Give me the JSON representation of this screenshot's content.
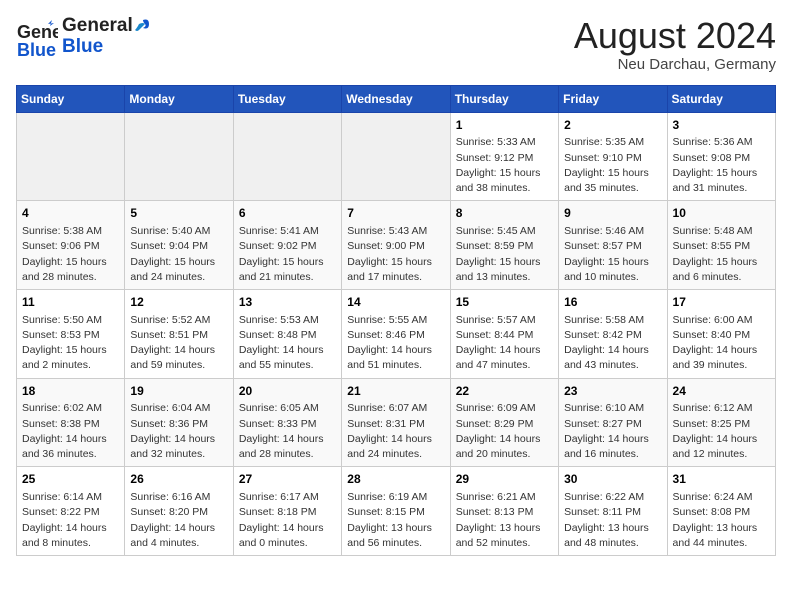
{
  "header": {
    "logo_general": "General",
    "logo_blue": "Blue",
    "title": "August 2024",
    "subtitle": "Neu Darchau, Germany"
  },
  "weekdays": [
    "Sunday",
    "Monday",
    "Tuesday",
    "Wednesday",
    "Thursday",
    "Friday",
    "Saturday"
  ],
  "weeks": [
    [
      {
        "day": "",
        "info": ""
      },
      {
        "day": "",
        "info": ""
      },
      {
        "day": "",
        "info": ""
      },
      {
        "day": "",
        "info": ""
      },
      {
        "day": "1",
        "info": "Sunrise: 5:33 AM\nSunset: 9:12 PM\nDaylight: 15 hours\nand 38 minutes."
      },
      {
        "day": "2",
        "info": "Sunrise: 5:35 AM\nSunset: 9:10 PM\nDaylight: 15 hours\nand 35 minutes."
      },
      {
        "day": "3",
        "info": "Sunrise: 5:36 AM\nSunset: 9:08 PM\nDaylight: 15 hours\nand 31 minutes."
      }
    ],
    [
      {
        "day": "4",
        "info": "Sunrise: 5:38 AM\nSunset: 9:06 PM\nDaylight: 15 hours\nand 28 minutes."
      },
      {
        "day": "5",
        "info": "Sunrise: 5:40 AM\nSunset: 9:04 PM\nDaylight: 15 hours\nand 24 minutes."
      },
      {
        "day": "6",
        "info": "Sunrise: 5:41 AM\nSunset: 9:02 PM\nDaylight: 15 hours\nand 21 minutes."
      },
      {
        "day": "7",
        "info": "Sunrise: 5:43 AM\nSunset: 9:00 PM\nDaylight: 15 hours\nand 17 minutes."
      },
      {
        "day": "8",
        "info": "Sunrise: 5:45 AM\nSunset: 8:59 PM\nDaylight: 15 hours\nand 13 minutes."
      },
      {
        "day": "9",
        "info": "Sunrise: 5:46 AM\nSunset: 8:57 PM\nDaylight: 15 hours\nand 10 minutes."
      },
      {
        "day": "10",
        "info": "Sunrise: 5:48 AM\nSunset: 8:55 PM\nDaylight: 15 hours\nand 6 minutes."
      }
    ],
    [
      {
        "day": "11",
        "info": "Sunrise: 5:50 AM\nSunset: 8:53 PM\nDaylight: 15 hours\nand 2 minutes."
      },
      {
        "day": "12",
        "info": "Sunrise: 5:52 AM\nSunset: 8:51 PM\nDaylight: 14 hours\nand 59 minutes."
      },
      {
        "day": "13",
        "info": "Sunrise: 5:53 AM\nSunset: 8:48 PM\nDaylight: 14 hours\nand 55 minutes."
      },
      {
        "day": "14",
        "info": "Sunrise: 5:55 AM\nSunset: 8:46 PM\nDaylight: 14 hours\nand 51 minutes."
      },
      {
        "day": "15",
        "info": "Sunrise: 5:57 AM\nSunset: 8:44 PM\nDaylight: 14 hours\nand 47 minutes."
      },
      {
        "day": "16",
        "info": "Sunrise: 5:58 AM\nSunset: 8:42 PM\nDaylight: 14 hours\nand 43 minutes."
      },
      {
        "day": "17",
        "info": "Sunrise: 6:00 AM\nSunset: 8:40 PM\nDaylight: 14 hours\nand 39 minutes."
      }
    ],
    [
      {
        "day": "18",
        "info": "Sunrise: 6:02 AM\nSunset: 8:38 PM\nDaylight: 14 hours\nand 36 minutes."
      },
      {
        "day": "19",
        "info": "Sunrise: 6:04 AM\nSunset: 8:36 PM\nDaylight: 14 hours\nand 32 minutes."
      },
      {
        "day": "20",
        "info": "Sunrise: 6:05 AM\nSunset: 8:33 PM\nDaylight: 14 hours\nand 28 minutes."
      },
      {
        "day": "21",
        "info": "Sunrise: 6:07 AM\nSunset: 8:31 PM\nDaylight: 14 hours\nand 24 minutes."
      },
      {
        "day": "22",
        "info": "Sunrise: 6:09 AM\nSunset: 8:29 PM\nDaylight: 14 hours\nand 20 minutes."
      },
      {
        "day": "23",
        "info": "Sunrise: 6:10 AM\nSunset: 8:27 PM\nDaylight: 14 hours\nand 16 minutes."
      },
      {
        "day": "24",
        "info": "Sunrise: 6:12 AM\nSunset: 8:25 PM\nDaylight: 14 hours\nand 12 minutes."
      }
    ],
    [
      {
        "day": "25",
        "info": "Sunrise: 6:14 AM\nSunset: 8:22 PM\nDaylight: 14 hours\nand 8 minutes."
      },
      {
        "day": "26",
        "info": "Sunrise: 6:16 AM\nSunset: 8:20 PM\nDaylight: 14 hours\nand 4 minutes."
      },
      {
        "day": "27",
        "info": "Sunrise: 6:17 AM\nSunset: 8:18 PM\nDaylight: 14 hours\nand 0 minutes."
      },
      {
        "day": "28",
        "info": "Sunrise: 6:19 AM\nSunset: 8:15 PM\nDaylight: 13 hours\nand 56 minutes."
      },
      {
        "day": "29",
        "info": "Sunrise: 6:21 AM\nSunset: 8:13 PM\nDaylight: 13 hours\nand 52 minutes."
      },
      {
        "day": "30",
        "info": "Sunrise: 6:22 AM\nSunset: 8:11 PM\nDaylight: 13 hours\nand 48 minutes."
      },
      {
        "day": "31",
        "info": "Sunrise: 6:24 AM\nSunset: 8:08 PM\nDaylight: 13 hours\nand 44 minutes."
      }
    ]
  ]
}
